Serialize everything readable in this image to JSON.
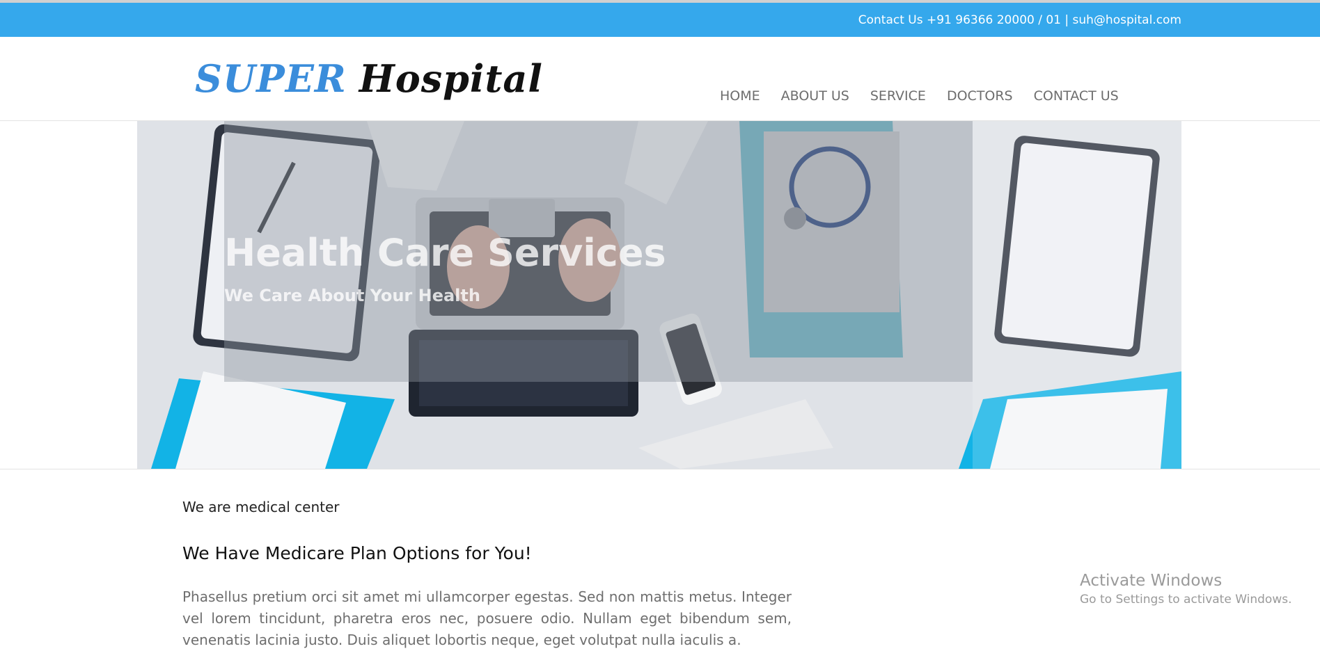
{
  "contact": {
    "text": "Contact Us +91 96366 20000 / 01 | suh@hospital.com"
  },
  "logo": {
    "word1": "SUPER",
    "word2": "Hospital"
  },
  "nav": [
    "HOME",
    "ABOUT US",
    "SERVICE",
    "DOCTORS",
    "CONTACT US"
  ],
  "hero": {
    "title": "Health Care Services",
    "subtitle": "We Care About Your Health"
  },
  "content": {
    "tagline": "We are medical center",
    "heading": "We Have Medicare Plan Options for You!",
    "paragraph": "Phasellus pretium orci sit amet mi ullamcorper egestas. Sed non mattis metus. Integer vel lorem tincidunt, pharetra eros nec, posuere odio. Nullam eget bibendum sem, venenatis lacinia justo. Duis aliquet lobortis neque, eget volutpat nulla iaculis a."
  },
  "watermark": {
    "title": "Activate Windows",
    "subtitle": "Go to Settings to activate Windows."
  },
  "colors": {
    "accent": "#35a8ec",
    "logo_blue": "#3b8ddb"
  }
}
